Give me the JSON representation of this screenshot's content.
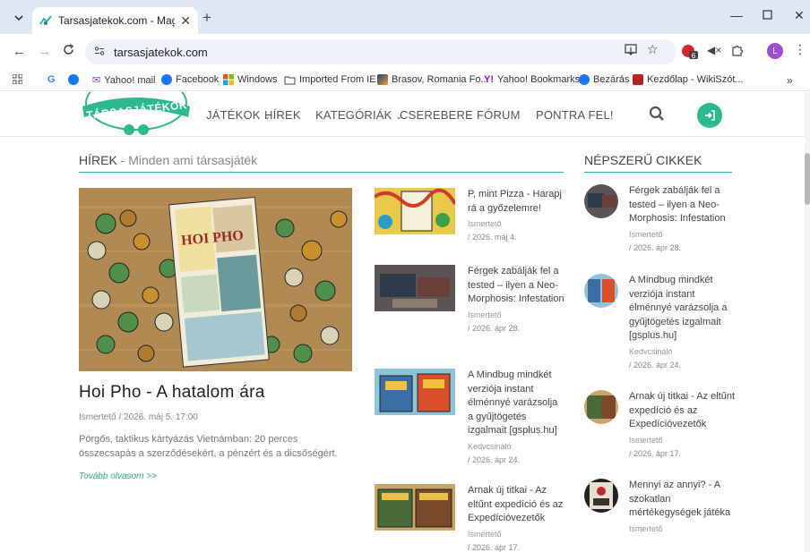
{
  "browser": {
    "tab_title": "Tarsasjatekok.com - Magyarorsz",
    "url": "tarsasjatekok.com",
    "bookmarks": [
      {
        "label": "",
        "icon": "apps-icon"
      },
      {
        "label": "",
        "icon": "google-icon"
      },
      {
        "label": "",
        "icon": "facebook-icon"
      },
      {
        "label": "Yahoo! mail",
        "icon": "mail-icon"
      },
      {
        "label": "Facebook",
        "icon": "facebook-icon"
      },
      {
        "label": "Windows",
        "icon": "windows-icon"
      },
      {
        "label": "Imported From IE",
        "icon": "folder-icon"
      },
      {
        "label": "Brasov, Romania Fo...",
        "icon": "bookmark-icon"
      },
      {
        "label": "Yahoo! Bookmarks",
        "icon": "yahoo-icon"
      },
      {
        "label": "Bezárás",
        "icon": "facebook-icon"
      },
      {
        "label": "Kezdőlap - WikiSzót...",
        "icon": "wiki-icon"
      }
    ],
    "extension_badge": "6",
    "profile_initial": "L",
    "colors": {
      "tabbar": "#dfe6f4",
      "omnibox": "#eef1f8",
      "profile": "#9c4fcf"
    }
  },
  "site": {
    "logo_text": "TÁRSASJÁTÉKOK",
    "menu": [
      "JÁTÉKOK",
      "HÍREK",
      "KATEGÓRIÁK",
      "CSEREBERE",
      "FÓRUM",
      "PONTRA FEL!"
    ],
    "accent_color": "#2cb98d"
  },
  "news": {
    "heading": "HÍREK",
    "subheading": "- Minden ami társasjáték",
    "featured": {
      "box_title": "HOI PHO",
      "title": "Hoi Pho - A hatalom ára",
      "category": "Ismertető",
      "date": "2026. máj 5. 17:00",
      "excerpt": "Pörgős, taktikus kártyázás Vietnámban: 20 perces összecsapás a szerződésekért, a pénzért és a dicsőségért.",
      "more": "Tovább olvasom >>"
    },
    "items": [
      {
        "title": "P, mint Pizza - Harapj rá a győzelemre!",
        "category": "Ismertető",
        "date": "/  2026. máj 4."
      },
      {
        "title": "Férgek zabálják fel a tested – ilyen a Neo-Morphosis: Infestation",
        "category": "Ismertető",
        "date": "/  2026. ápr 28."
      },
      {
        "title": "A Mindbug mindkét verziója instant élménnyé varázsolja a gyűjtögetés izgalmait [gsplus.hu]",
        "category": "Kedvcsináló",
        "date": "/  2026. ápr 24."
      },
      {
        "title": "Arnak új titkai - Az eltűnt expedíció és az Expedícióvezetők",
        "category": "Ismertető",
        "date": "/  2026. ápr 17."
      }
    ]
  },
  "popular": {
    "heading": "NÉPSZERŰ CIKKEK",
    "items": [
      {
        "title": "Férgek zabálják fel a tested – ilyen a Neo-Morphosis: Infestation",
        "category": "Ismertető",
        "date": "/  2026. ápr 28."
      },
      {
        "title": "A Mindbug mindkét verziója instant élménnyé varázsolja a gyűjtögetés izgalmait [gsplus.hu]",
        "category": "Kedvcsináló",
        "date": "/  2026. ápr 24."
      },
      {
        "title": "Arnak új titkai - Az eltűnt expedíció és az Expedícióvezetők",
        "category": "Ismertető",
        "date": "/  2026. ápr 17."
      },
      {
        "title": "Mennyi az annyi? - A szokatlan mértékegységek játéka",
        "category": "Ismertető",
        "date": ""
      }
    ]
  }
}
